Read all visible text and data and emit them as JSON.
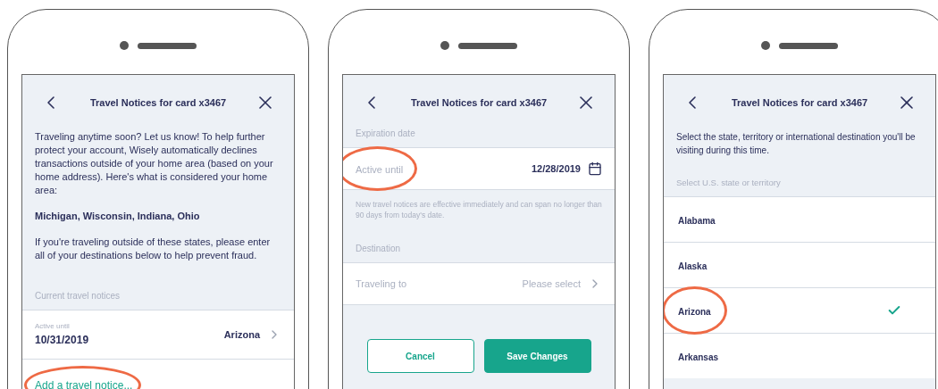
{
  "phones": [
    {
      "kind": "info",
      "header": {
        "title": "Travel Notices for card x3467"
      },
      "paragraphs": [
        {
          "text": "Traveling anytime soon? Let us know! To help further protect your account, Wisely automatically declines transactions outside of your home area (based on your home address). Here's what is considered your home area:",
          "emphasis": false
        },
        {
          "text": "Michigan, Wisconsin, Indiana, Ohio",
          "emphasis": true
        },
        {
          "text": "If you're traveling outside of these states, please enter all of your destinations below to help prevent fraud.",
          "emphasis": false
        }
      ],
      "section_label": "Current travel notices",
      "notices": [
        {
          "label": "Active until",
          "date": "10/31/2019",
          "destination": "Arizona"
        }
      ],
      "add_link": {
        "text": "Add a travel notice...",
        "highlighted": true
      }
    },
    {
      "kind": "form",
      "header": {
        "title": "Travel Notices for card x3467"
      },
      "expiration": {
        "section_label": "Expiration date",
        "label": "Active until",
        "value": "12/28/2019",
        "highlighted": true
      },
      "note": "New travel notices are effective immediately and can span no longer than 90 days from today's date.",
      "destination": {
        "section_label": "Destination",
        "label": "Traveling to",
        "placeholder": "Please select"
      },
      "buttons": [
        {
          "label": "Cancel",
          "kind": "secondary"
        },
        {
          "label": "Save Changes",
          "kind": "primary"
        }
      ]
    },
    {
      "kind": "picker",
      "header": {
        "title": "Travel Notices for card x3467"
      },
      "intro": "Select the state, territory or international destination you'll be visiting during this time.",
      "section_label": "Select U.S. state or territory",
      "options": [
        {
          "label": "Alabama",
          "selected": false,
          "highlighted": false
        },
        {
          "label": "Alaska",
          "selected": false,
          "highlighted": false
        },
        {
          "label": "Arizona",
          "selected": true,
          "highlighted": true
        },
        {
          "label": "Arkansas",
          "selected": false,
          "highlighted": false
        }
      ]
    }
  ]
}
